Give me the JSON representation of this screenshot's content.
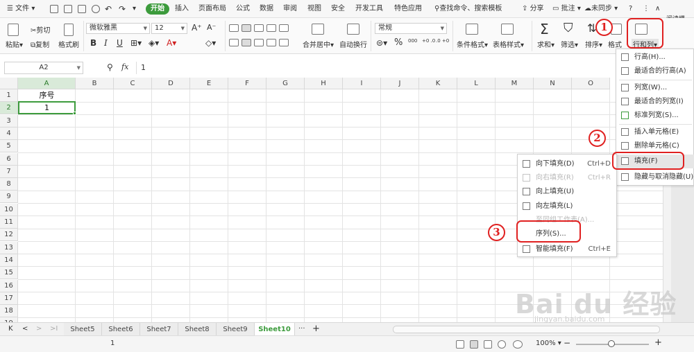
{
  "menubar": {
    "file": "文件",
    "items": [
      "开始",
      "插入",
      "页面布局",
      "公式",
      "数据",
      "审阅",
      "视图",
      "安全",
      "开发工具",
      "特色应用"
    ],
    "active_index": 0,
    "search": "查找命令、搜索模板",
    "share": "分享",
    "comment": "批注",
    "sync": "未同步",
    "help": "?",
    "more": "⋮",
    "collapse": "∧",
    "reading_mode": "阅读模"
  },
  "ribbon": {
    "cut": "剪切",
    "paste": "粘贴",
    "copy": "复制",
    "format_painter": "格式刷",
    "font_name": "微软雅黑",
    "font_size": "12",
    "bold": "B",
    "italic": "I",
    "underline": "U",
    "font_color_letter": "A",
    "merge_center": "合并居中",
    "wrap_text": "自动换行",
    "number_format": "常规",
    "percent": "%",
    "thousand": "000",
    "dec_inc": "+0 .0",
    "dec_dec": ".0 +0",
    "conditional_format": "条件格式",
    "table_style": "表格样式",
    "sum": "求和",
    "filter": "筛选",
    "sort": "排序",
    "format": "格式",
    "row_col": "行和列",
    "grow_font": "A⁺",
    "shrink_font": "A⁻"
  },
  "formula_bar": {
    "cell_ref": "A2",
    "fx": "fx",
    "value": "1"
  },
  "grid": {
    "columns": [
      "A",
      "B",
      "C",
      "D",
      "E",
      "F",
      "G",
      "H",
      "I",
      "J",
      "K",
      "L",
      "M",
      "N",
      "O"
    ],
    "rows": [
      "1",
      "2",
      "3",
      "4",
      "5",
      "6",
      "7",
      "8",
      "9",
      "10",
      "11",
      "12",
      "13",
      "14",
      "15",
      "16",
      "17",
      "18",
      "19"
    ],
    "a1": "序号",
    "a2": "1"
  },
  "row_col_menu": {
    "items": [
      {
        "label": "行高(H)..."
      },
      {
        "label": "最适合的行高(A)"
      },
      {
        "label": "列宽(W)..."
      },
      {
        "label": "最适合的列宽(I)"
      },
      {
        "label": "标准列宽(S)..."
      },
      {
        "label": "插入单元格(E)"
      },
      {
        "label": "删除单元格(C)"
      },
      {
        "label": "填充(F)"
      },
      {
        "label": "隐藏与取消隐藏(U)"
      }
    ]
  },
  "fill_menu": {
    "items": [
      {
        "label": "向下填充(D)",
        "shortcut": "Ctrl+D",
        "disabled": false
      },
      {
        "label": "向右填充(R)",
        "shortcut": "Ctrl+R",
        "disabled": true
      },
      {
        "label": "向上填充(U)",
        "shortcut": "",
        "disabled": false
      },
      {
        "label": "向左填充(L)",
        "shortcut": "",
        "disabled": false
      },
      {
        "label": "至同组工作表(A)...",
        "shortcut": "",
        "disabled": true
      },
      {
        "label": "序列(S)...",
        "shortcut": "",
        "disabled": false
      },
      {
        "label": "智能填充(F)",
        "shortcut": "Ctrl+E",
        "disabled": false
      }
    ]
  },
  "annotations": {
    "step1": "1",
    "step2": "2",
    "step3": "3"
  },
  "sheets": {
    "tabs": [
      "Sheet5",
      "Sheet6",
      "Sheet7",
      "Sheet8",
      "Sheet9",
      "Sheet10"
    ],
    "active": "Sheet10",
    "more": "···",
    "add": "+"
  },
  "status": {
    "count": "1",
    "zoom": "100%",
    "zoom_minus": "−",
    "zoom_plus": "+",
    "zoom_level_percent": 100
  },
  "watermark": {
    "brand": "Bai du 经验",
    "url": "jingyan.baidu.com"
  },
  "colors": {
    "accent_green": "#3c9b3c",
    "annotation_red": "#e02020"
  }
}
